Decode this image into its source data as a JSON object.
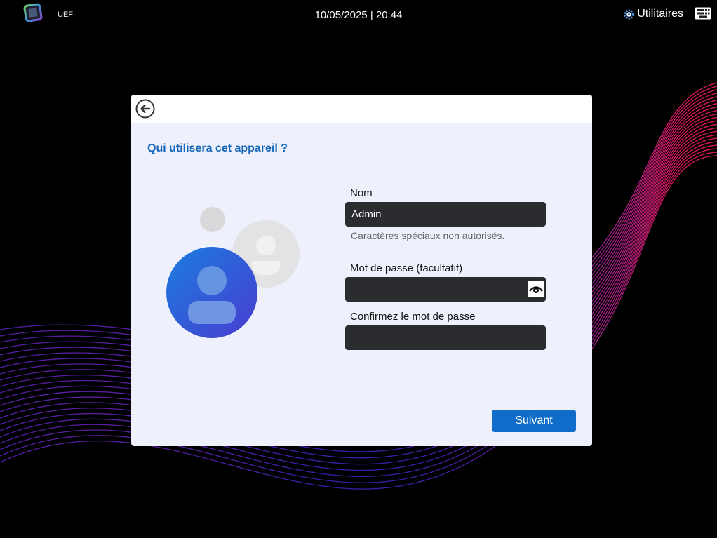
{
  "topbar": {
    "firmware_label": "UEFI",
    "datetime": "10/05/2025 | 20:44",
    "utilities_label": "Utilitaires",
    "utilities_icon": "gear-icon",
    "keyboard_icon": "keyboard-icon"
  },
  "dialog": {
    "back_icon": "back-arrow-icon",
    "title": "Qui utilisera cet appareil ?",
    "fields": {
      "name": {
        "label": "Nom",
        "value": "Admin",
        "hint": "Caractères spéciaux non autorisés."
      },
      "password": {
        "label": "Mot de passe (facultatif)",
        "value": "",
        "toggle_icon": "eye-icon"
      },
      "confirm_password": {
        "label": "Confirmez le mot de passe",
        "value": ""
      }
    },
    "next_label": "Suivant"
  },
  "colors": {
    "accent": "#0f6cc9",
    "title": "#1565b8",
    "field_bg": "#2b2c30",
    "dialog_bg": "#eef1fb",
    "wave_start": "#e0185a",
    "wave_end": "#3a1ea8"
  }
}
